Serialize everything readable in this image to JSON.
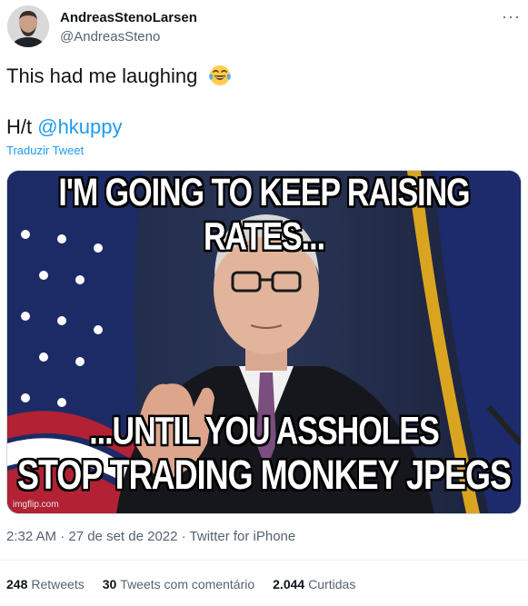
{
  "author": {
    "name": "AndreasStenoLarsen",
    "handle": "@AndreasSteno"
  },
  "tweet": {
    "text_line1": "This had me laughing",
    "emoji": "face-with-tears-of-joy",
    "ht_prefix": "H/t ",
    "mention": "@hkuppy",
    "translate_label": "Traduzir Tweet"
  },
  "media": {
    "top_caption": "I'M GOING TO KEEP RAISING RATES...",
    "bottom_caption_line1": "...UNTIL YOU ASSHOLES",
    "bottom_caption_line2": "STOP TRADING MONKEY JPEGS",
    "watermark": "imgflip.com"
  },
  "meta": {
    "timestamp": "2:32 AM · 27 de set de 2022 · Twitter for iPhone"
  },
  "stats": {
    "retweets_count": "248",
    "retweets_label": "Retweets",
    "quotes_count": "30",
    "quotes_label": "Tweets com comentário",
    "likes_count": "2.044",
    "likes_label": "Curtidas"
  },
  "colors": {
    "link": "#1d9bf0",
    "text": "#0f1419",
    "muted": "#536471"
  }
}
